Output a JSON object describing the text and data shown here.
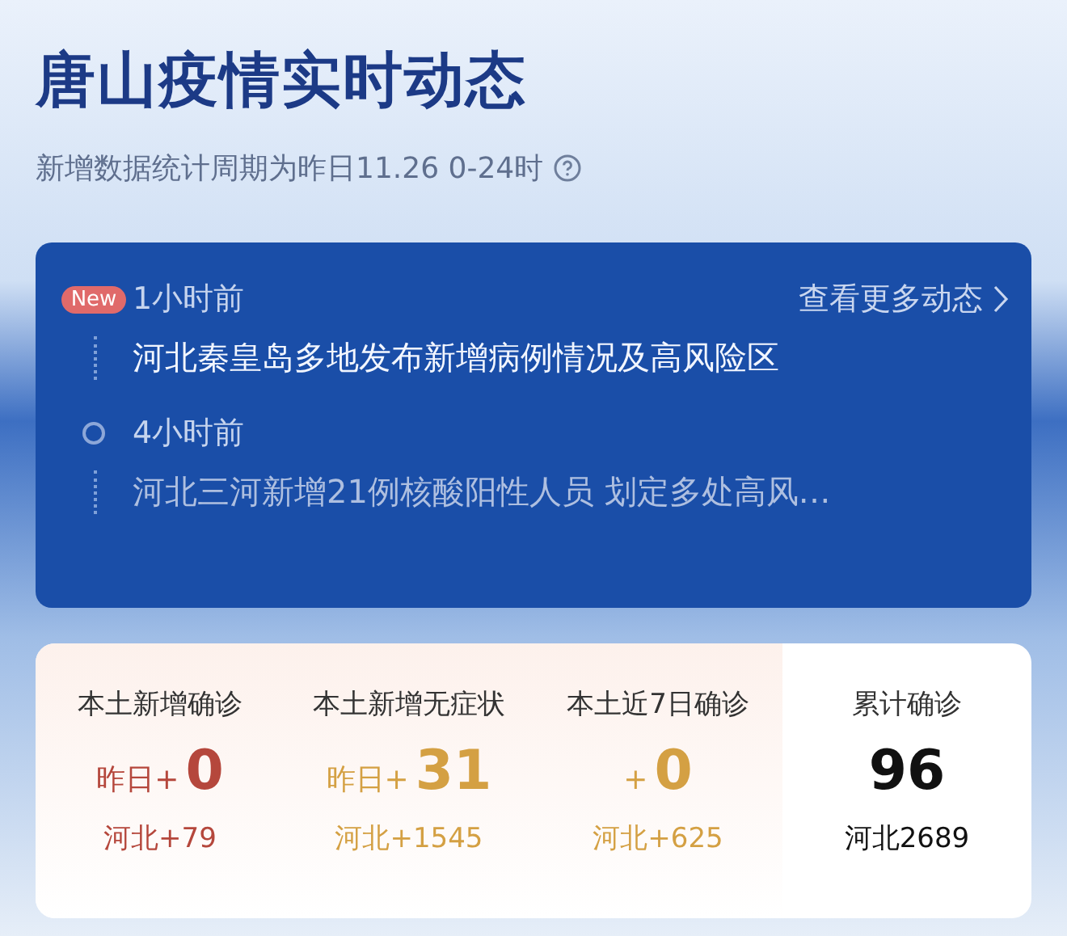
{
  "header": {
    "title": "唐山疫情实时动态",
    "subtitle": "新增数据统计周期为昨日11.26 0-24时"
  },
  "feed": {
    "more_link": "查看更多动态",
    "items": [
      {
        "badge": "New",
        "time": "1小时前",
        "headline": "河北秦皇岛多地发布新增病例情况及高风险区"
      },
      {
        "time": "4小时前",
        "headline": "河北三河新增21例核酸阳性人员 划定多处高风…"
      }
    ]
  },
  "stats": [
    {
      "label": "本土新增确诊",
      "prefix": "昨日+",
      "value": "0",
      "region": "河北+79",
      "color": "#b5473c"
    },
    {
      "label": "本土新增无症状",
      "prefix": "昨日+",
      "value": "31",
      "region": "河北+1545",
      "color": "#d4a043"
    },
    {
      "label": "本土近7日确诊",
      "prefix": "+",
      "value": "0",
      "region": "河北+625",
      "color": "#d4a043"
    },
    {
      "label": "累计确诊",
      "value": "96",
      "region": "河北2689",
      "color": "#111111"
    }
  ]
}
